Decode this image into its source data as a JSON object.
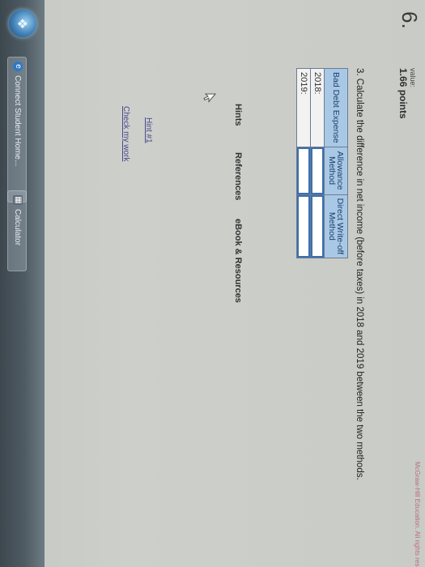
{
  "question": {
    "number": "6.",
    "value_label": "value:",
    "points": "1.66 points",
    "prompt": "3. Calculate the difference in net income (before taxes) in 2018 and 2019 between the two methods."
  },
  "table": {
    "headers": [
      "Bad Debt Expense",
      "Allowance Method",
      "Direct Write-off Method"
    ],
    "header_lines": [
      [
        "Bad Debt Expense"
      ],
      [
        "Allowance",
        "Method"
      ],
      [
        "Direct Write-off",
        "Method"
      ]
    ],
    "rows": [
      {
        "label": "2018:",
        "allowance": "",
        "direct": ""
      },
      {
        "label": "2019:",
        "allowance": "",
        "direct": ""
      }
    ]
  },
  "tabs": {
    "hints": "Hints",
    "references": "References",
    "ebook": "eBook & Resources"
  },
  "links": {
    "hint": "Hint #1",
    "check_work": "Check my work"
  },
  "footer": {
    "copyright": "McGraw-Hill Education. All rights reserved."
  },
  "taskbar": {
    "items": [
      {
        "label": "Connect Student Home...",
        "icon": "internet-explorer-icon"
      },
      {
        "label": "Calculator",
        "icon": "calculator-icon"
      }
    ],
    "start_icon": "windows-orb-icon"
  },
  "colors": {
    "table_header": "#a8c8e6",
    "input_border": "#3c6fb0",
    "link": "#4a4a8a",
    "taskbar": "#4f5b63"
  }
}
